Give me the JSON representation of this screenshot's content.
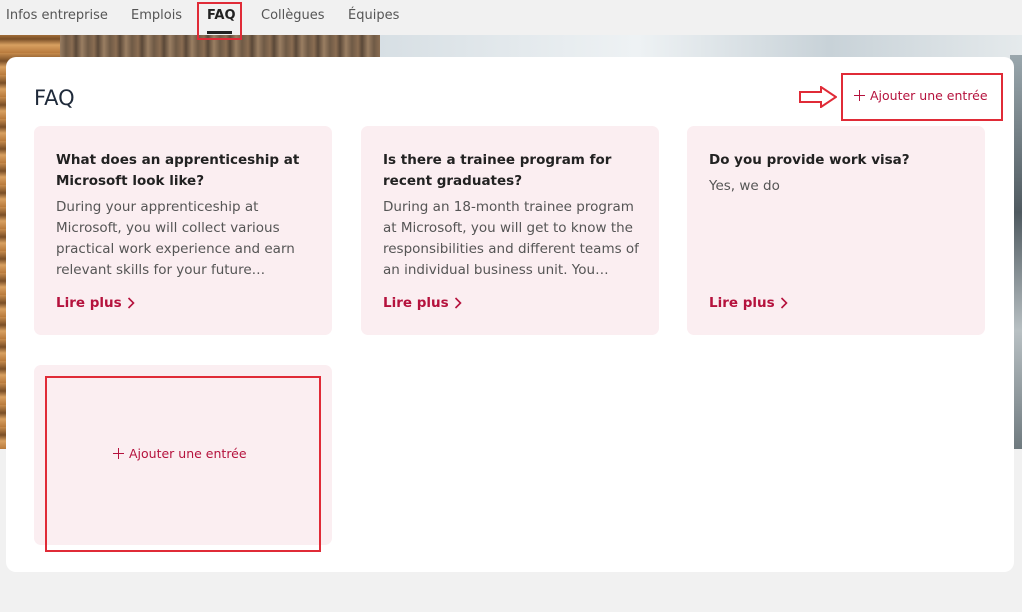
{
  "tabs": [
    {
      "label": "Infos entreprise"
    },
    {
      "label": "Emplois"
    },
    {
      "label": "FAQ",
      "active": true
    },
    {
      "label": "Collègues"
    },
    {
      "label": "Équipes"
    }
  ],
  "panel": {
    "title": "FAQ",
    "add_label": "Ajouter une entrée"
  },
  "faq": [
    {
      "question": "What does an apprenticeship at Microsoft look like?",
      "answer": "During your apprenticeship at Microsoft, you will collect various practical work experience and earn relevant skills for your future…",
      "more": "Lire plus"
    },
    {
      "question": "Is there a trainee program for recent graduates?",
      "answer": "During an 18-month trainee program at Microsoft, you will get to know the responsibilities and different teams of an individual business unit. You…",
      "more": "Lire plus"
    },
    {
      "question": "Do you provide work visa?",
      "answer": "Yes, we do",
      "more": "Lire plus"
    }
  ],
  "empty_card": {
    "add_label": "Ajouter une entrée"
  },
  "colors": {
    "accent": "#b5123d",
    "card_bg": "#fbeef1",
    "annotation": "#e02b37"
  },
  "icons": [
    "plus-icon",
    "chevron-right-icon",
    "arrow-right-icon"
  ]
}
